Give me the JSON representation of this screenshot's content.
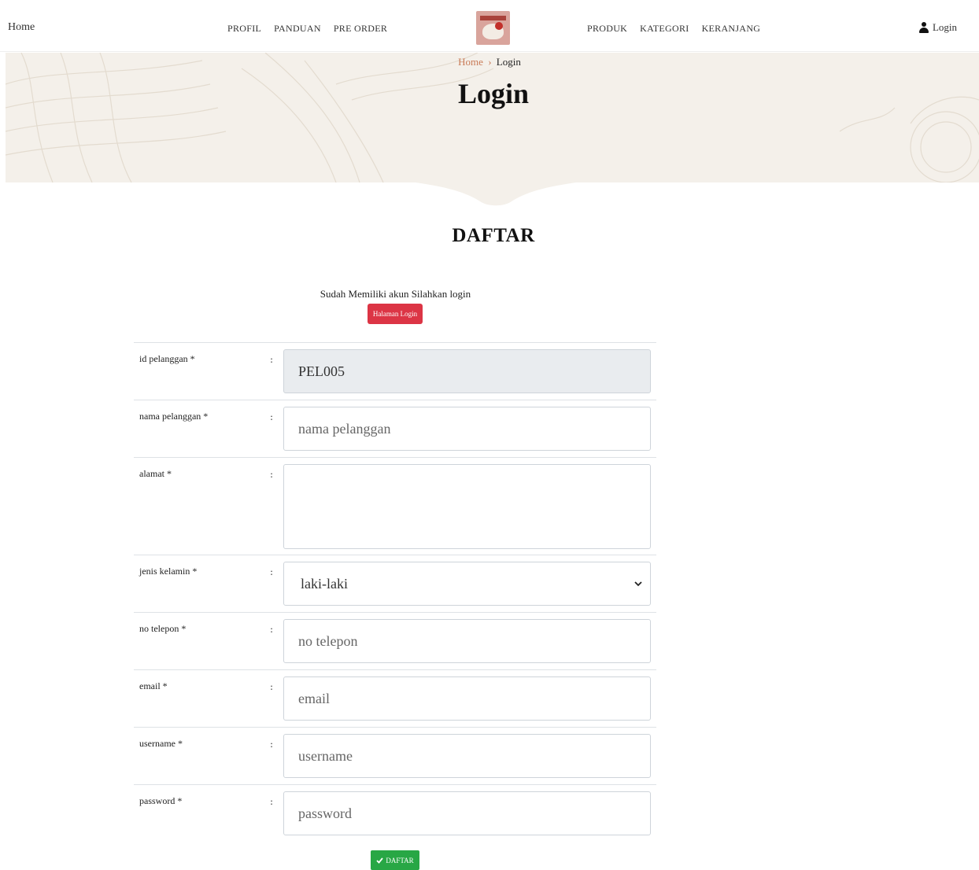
{
  "nav": {
    "home": "Home",
    "left_links": [
      "PROFIL",
      "PANDUAN",
      "PRE ORDER"
    ],
    "right_links": [
      "PRODUK",
      "KATEGORI",
      "KERANJANG"
    ],
    "login": "Login",
    "login_icon": "user-icon"
  },
  "hero": {
    "breadcrumb_home": "Home",
    "breadcrumb_sep": "›",
    "breadcrumb_current": "Login",
    "title": "Login"
  },
  "section_title": "DAFTAR",
  "login_prompt": {
    "text": "Sudah Memiliki akun Silahkan login",
    "button": "Halaman Login",
    "button_color": "#dc3545"
  },
  "form": {
    "colon": ":",
    "fields": {
      "id_pelanggan": {
        "label": "id pelanggan *",
        "value": "PEL005"
      },
      "nama_pelanggan": {
        "label": "nama pelanggan *",
        "placeholder": "nama pelanggan"
      },
      "alamat": {
        "label": "alamat *",
        "value": ""
      },
      "jenis_kelamin": {
        "label": "jenis kelamin *",
        "selected": "laki-laki"
      },
      "no_telepon": {
        "label": "no telepon *",
        "placeholder": "no telepon"
      },
      "email": {
        "label": "email *",
        "placeholder": "email"
      },
      "username": {
        "label": "username *",
        "placeholder": "username"
      },
      "password": {
        "label": "password *",
        "placeholder": "password"
      }
    },
    "submit": "DAFTAR",
    "submit_icon": "check-icon",
    "submit_color": "#28a745"
  }
}
